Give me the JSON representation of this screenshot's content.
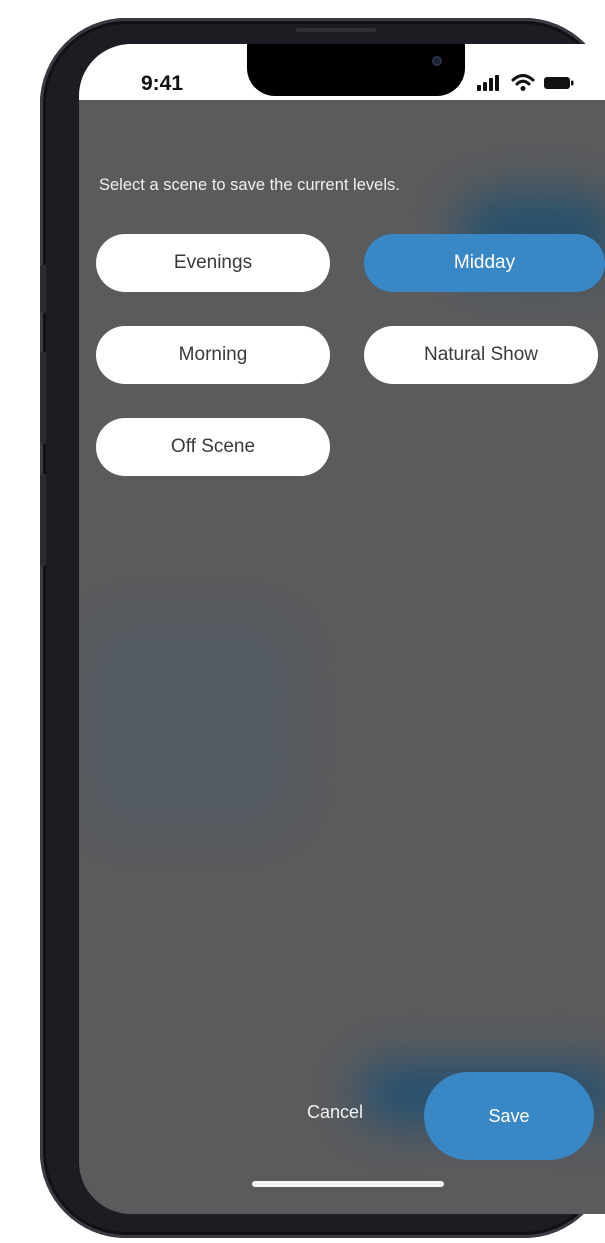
{
  "status_bar": {
    "time": "9:41",
    "icons": [
      "signal-icon",
      "wifi-icon",
      "battery-icon"
    ]
  },
  "instruction": "Select a scene to save the current levels.",
  "scenes": [
    {
      "label": "Evenings",
      "selected": false
    },
    {
      "label": "Midday",
      "selected": true
    },
    {
      "label": "Morning",
      "selected": false
    },
    {
      "label": "Natural Show",
      "selected": false
    },
    {
      "label": "Off Scene",
      "selected": false
    }
  ],
  "actions": {
    "cancel_label": "Cancel",
    "save_label": "Save"
  },
  "colors": {
    "accent": "#3a87c6",
    "overlay": "#5a5b5d",
    "pill_bg": "#ffffff"
  }
}
